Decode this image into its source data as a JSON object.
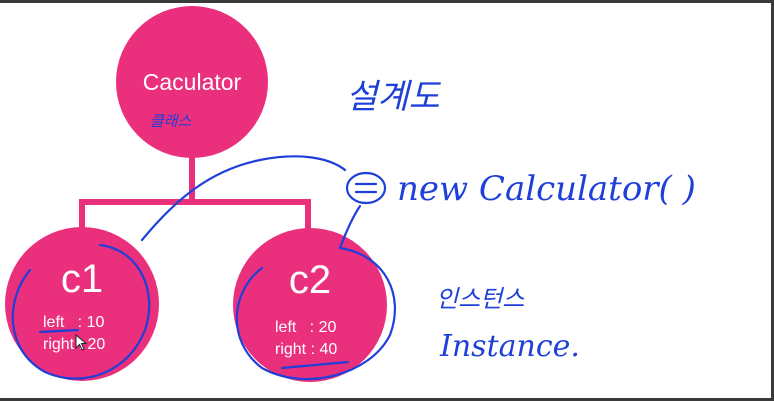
{
  "colors": {
    "node": "#ea2f7d",
    "ink": "#1f3fd9"
  },
  "root": {
    "title": "Caculator",
    "annotation": "클래스"
  },
  "instances": [
    {
      "name": "c1",
      "field1": "left   : 10",
      "field2": "right : 20"
    },
    {
      "name": "c2",
      "field1": "left   : 20",
      "field2": "right : 40"
    }
  ],
  "annotations": {
    "blueprint": "설계도",
    "equals": "=",
    "constructor": "new  Calculator( )",
    "instance_ko": "인스턴스",
    "instance_en": "Instance."
  }
}
